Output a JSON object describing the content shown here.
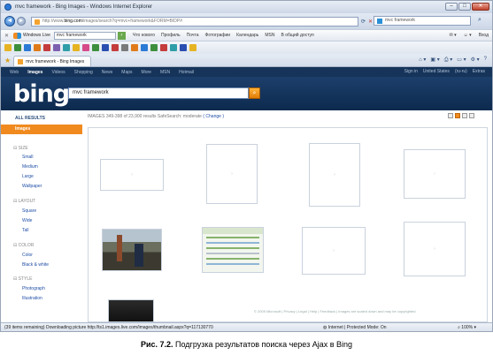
{
  "window": {
    "title": "mvc framework - Bing Images - Windows Internet Explorer"
  },
  "address_bar": {
    "url_prefix": "http://www.",
    "url_domain": "bing.com",
    "url_rest": "/images/search?q=mvc+framework&FORM=BIDP#",
    "search_text": "mvc framework",
    "back_label": "◄",
    "forward_label": "►"
  },
  "live_toolbar": {
    "brand": "Windows Live",
    "query": "mvc framework",
    "menus": [
      "Что нового",
      "Профиль",
      "Почта",
      "Фотографии",
      "Календарь",
      "MSN",
      "В общий доступ"
    ],
    "signin": "Вход"
  },
  "tab": {
    "label": "mvc framework - Bing Images"
  },
  "bing": {
    "nav": [
      "Web",
      "Images",
      "Videos",
      "Shopping",
      "News",
      "Maps",
      "More",
      "MSN",
      "Hotmail"
    ],
    "nav_active": "Images",
    "nav_right": [
      "Sign in",
      "United States",
      "(ru-ru)",
      "Extras"
    ],
    "logo": "bing",
    "query": "mvc framework",
    "search_button_icon": "search-icon"
  },
  "sidebar": {
    "all_results": "ALL RESULTS",
    "images": "Images",
    "groups": [
      {
        "label": "SIZE",
        "items": [
          "Small",
          "Medium",
          "Large",
          "Wallpaper"
        ]
      },
      {
        "label": "LAYOUT",
        "items": [
          "Square",
          "Wide",
          "Tall"
        ]
      },
      {
        "label": "COLOR",
        "items": [
          "Color",
          "Black & white"
        ]
      },
      {
        "label": "STYLE",
        "items": [
          "Photograph",
          "Illustration"
        ]
      }
    ]
  },
  "results": {
    "header": "IMAGES   349-398 of 23,900 results   SafeSearch: moderate",
    "change_link": "( Change )"
  },
  "footer_links": "© 2009 Microsoft  |  Privacy  |  Legal  |  Help  |  Feedback  |  Images are scaled down and may be copyrighted",
  "status": {
    "left": "(39 items remaining) Downloading picture http://ts1.images.live.com/images/thumbnail.aspx?q=117130770",
    "zone": "Internet | Protected Mode: On",
    "zoom": "100%"
  },
  "caption": {
    "label": "Рис. 7.2.",
    "text": " Подгрузка результатов поиска через Ajax в Bing"
  }
}
